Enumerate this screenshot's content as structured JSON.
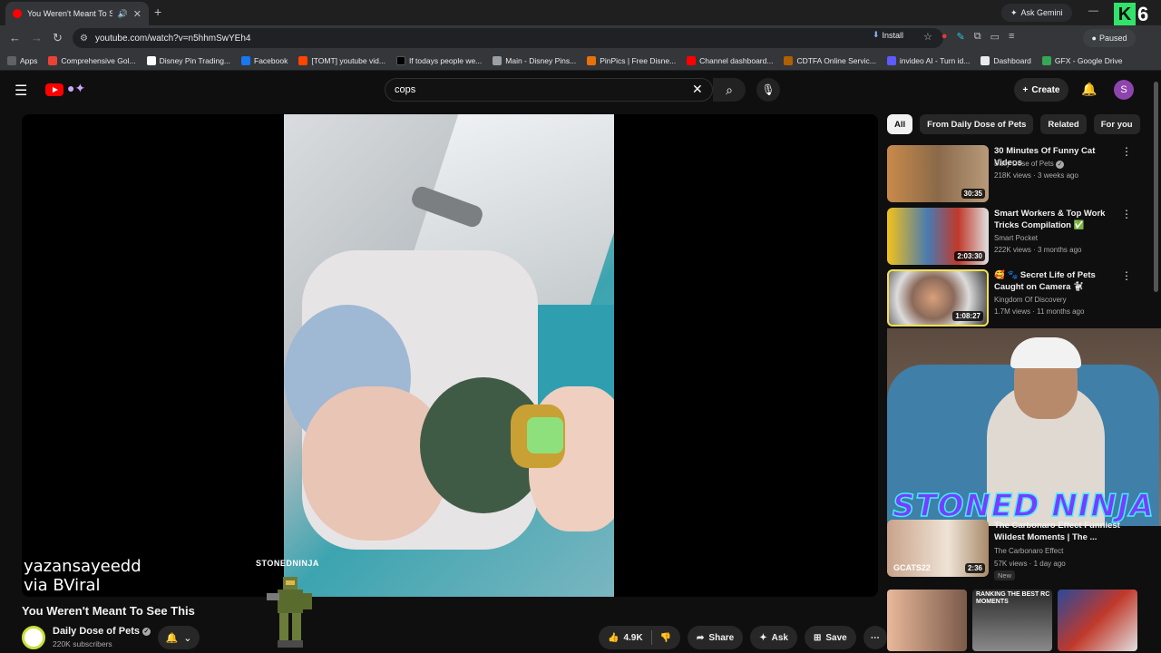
{
  "browser": {
    "tab_title": "You Weren't Meant To See This",
    "new_tab": "+",
    "gemini": "Ask Gemini",
    "url": "youtube.com/watch?v=n5hhmSwYEh4",
    "install": "Install",
    "paused": "Paused",
    "window_controls": [
      "—",
      "▢",
      "✕"
    ],
    "k6": {
      "k": "K",
      "six": "6"
    }
  },
  "bookmarks": [
    {
      "label": "Apps",
      "color": "#5f6368"
    },
    {
      "label": "Comprehensive Gol...",
      "color": "#ea4335"
    },
    {
      "label": "Disney Pin Trading...",
      "color": "#ffffff"
    },
    {
      "label": "Facebook",
      "color": "#1877f2"
    },
    {
      "label": "[TOMT] youtube vid...",
      "color": "#ff4500"
    },
    {
      "label": "If todays people we...",
      "color": "#000000"
    },
    {
      "label": "Main - Disney Pins...",
      "color": "#9aa0a6"
    },
    {
      "label": "PinPics | Free Disne...",
      "color": "#e8710a"
    },
    {
      "label": "Channel dashboard...",
      "color": "#ff0000"
    },
    {
      "label": "CDTFA Online Servic...",
      "color": "#b06000"
    },
    {
      "label": "invideo AI - Turn id...",
      "color": "#5b5bff"
    },
    {
      "label": "Dashboard",
      "color": "#e8eaed"
    },
    {
      "label": "GFX - Google Drive",
      "color": "#34a853"
    }
  ],
  "youtube": {
    "search_value": "cops",
    "create_label": "Create",
    "avatar_letter": "S"
  },
  "video": {
    "watermark_line1": "yazansayeedd",
    "watermark_line2": "via BViral",
    "overlay_small": "STONEDNINJA",
    "title": "You Weren't Meant To See This",
    "channel": "Daily Dose of Pets",
    "subscribers": "220K subscribers",
    "likes": "4.9K",
    "share": "Share",
    "ask": "Ask",
    "save": "Save"
  },
  "chips": [
    "All",
    "From Daily Dose of Pets",
    "Related",
    "For you"
  ],
  "recommendations": [
    {
      "title": "30 Minutes Of Funny Cat Videos",
      "channel": "Daily Dose of Pets",
      "meta": "218K views · 3 weeks ago",
      "duration": "30:35"
    },
    {
      "title": "Smart Workers & Top Work Tricks Compilation ✅",
      "channel": "Smart Pocket",
      "meta": "222K views · 3 months ago",
      "duration": "2:03:30"
    },
    {
      "title": "🥰 🐾 Secret Life of Pets Caught on Camera 🐩",
      "channel": "Kingdom Of Discovery",
      "meta": "1.7M views · 11 months ago",
      "duration": "1:08:27"
    },
    {
      "title": "The Carbonaro Effect Funniest Wildest Moments | The ...",
      "channel": "The Carbonaro Effect",
      "meta": "57K views · 1 day ago",
      "duration": "2:36",
      "badge": "New"
    }
  ],
  "stream_overlay": "STONED NINJA",
  "thumb_overlay": "GCATS22",
  "bottom_thumb_text": "RANKING THE BEST RC MOMENTS"
}
